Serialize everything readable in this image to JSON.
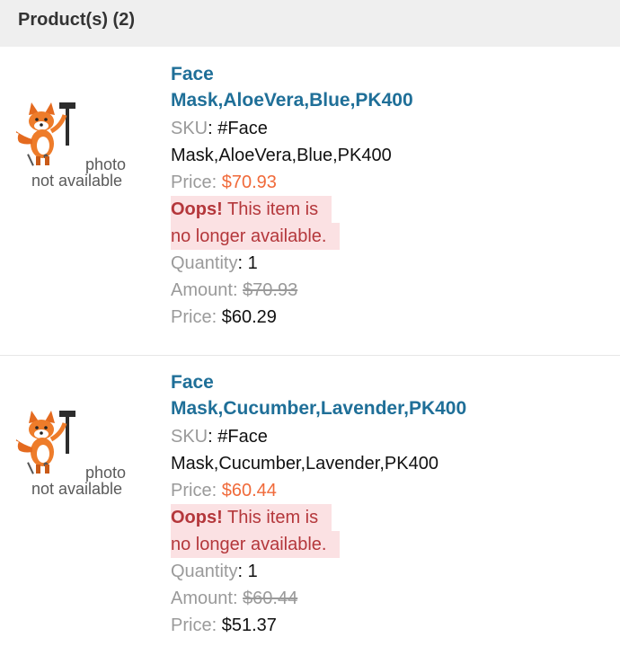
{
  "header": {
    "title": "Product(s) (2)"
  },
  "labels": {
    "sku": "SKU",
    "price": "Price",
    "quantity": "Quantity",
    "amount": "Amount",
    "oops": "Oops!",
    "unavailable_l1": "This item is",
    "unavailable_l2": "no longer available.",
    "photo_l1": "photo",
    "photo_l2": "not available"
  },
  "products": [
    {
      "title_l1": "Face",
      "title_l2": "Mask,AloeVera,Blue,PK400",
      "sku_l1": "#Face",
      "sku_l2": "Mask,AloeVera,Blue,PK400",
      "price": "$70.93",
      "quantity": "1",
      "amount": "$70.93",
      "final_price": "$60.29"
    },
    {
      "title_l1": "Face",
      "title_l2": "Mask,Cucumber,Lavender,PK400",
      "sku_l1": "#Face",
      "sku_l2": "Mask,Cucumber,Lavender,PK400",
      "price": "$60.44",
      "quantity": "1",
      "amount": "$60.44",
      "final_price": "$51.37"
    }
  ]
}
